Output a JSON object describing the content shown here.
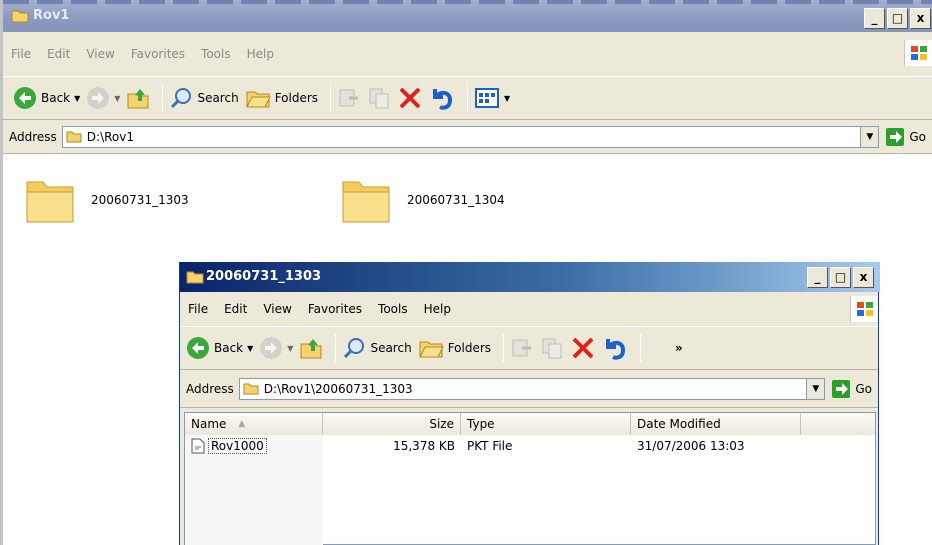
{
  "outer": {
    "title": "Rov1",
    "controls": [
      "_",
      "□",
      "x"
    ],
    "menu": [
      "File",
      "Edit",
      "View",
      "Favorites",
      "Tools",
      "Help"
    ],
    "toolbar": {
      "back": "Back",
      "search": "Search",
      "folders": "Folders"
    },
    "address": {
      "label": "Address",
      "value": "D:\\Rov1",
      "go": "Go"
    },
    "folders": [
      {
        "name": "20060731_1303"
      },
      {
        "name": "20060731_1304"
      }
    ]
  },
  "inner": {
    "title": "20060731_1303",
    "controls": [
      "_",
      "□",
      "x"
    ],
    "menu": [
      "File",
      "Edit",
      "View",
      "Favorites",
      "Tools",
      "Help"
    ],
    "toolbar": {
      "back": "Back",
      "search": "Search",
      "folders": "Folders",
      "more": "»"
    },
    "address": {
      "label": "Address",
      "value": "D:\\Rov1\\20060731_1303",
      "go": "Go"
    },
    "columns": [
      "Name",
      "Size",
      "Type",
      "Date Modified"
    ],
    "files": [
      {
        "name": "Rov1000",
        "size": "15,378 KB",
        "type": "PKT File",
        "modified": "31/07/2006 13:03"
      }
    ]
  },
  "colors": {
    "active_title": "#0a246a",
    "inactive_title": "#8d9cc0",
    "delete_red": "#e0201a",
    "go_green": "#2aa02a"
  }
}
